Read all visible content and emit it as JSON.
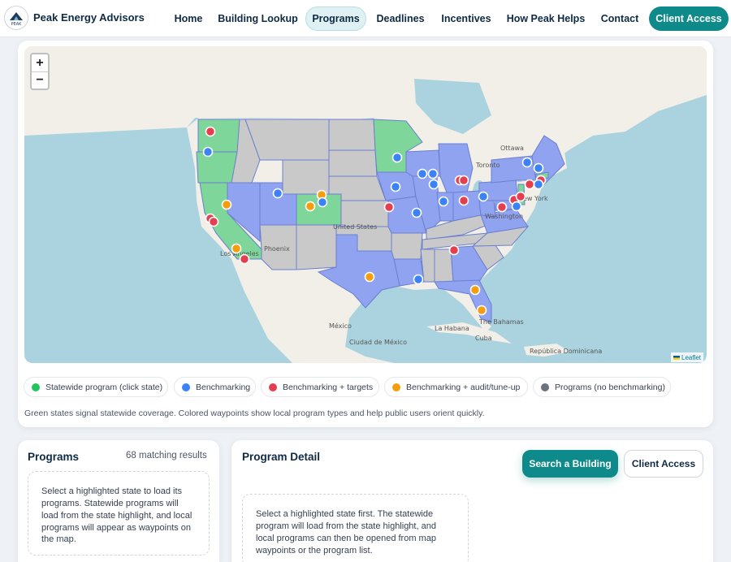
{
  "brand": {
    "name": "Peak Energy Advisors",
    "logo_text": "PEAK",
    "logo_icon": "mountain-icon"
  },
  "nav": {
    "items": [
      {
        "label": "Home",
        "active": false
      },
      {
        "label": "Building Lookup",
        "active": false
      },
      {
        "label": "Programs",
        "active": true
      },
      {
        "label": "Deadlines",
        "active": false
      },
      {
        "label": "Incentives",
        "active": false
      },
      {
        "label": "How Peak Helps",
        "active": false
      },
      {
        "label": "Contact",
        "active": false
      }
    ],
    "cta": "Client Access"
  },
  "map": {
    "zoom_in": "+",
    "zoom_out": "−",
    "attribution": "Leaflet",
    "place_labels": [
      "Ottawa",
      "Toronto",
      "New York",
      "Washington",
      "United States",
      "Phoenix",
      "Los Angeles",
      "México",
      "Ciudad de México",
      "La Habana",
      "Cuba",
      "The Bahamas",
      "República Dominicana"
    ],
    "colors": {
      "water": "#aad3df",
      "land": "#f2efe9",
      "statewide": "#7fd69a",
      "benchmarking": "#8fa3f0",
      "no_benchmarking": "#c9c9c9",
      "dot_benchmarking": "#3b82f6",
      "dot_targets": "#e53e4f",
      "dot_audit": "#f59e0b",
      "dot_none": "#6b7280",
      "dot_statewide": "#22c55e"
    }
  },
  "legend": [
    {
      "label": "Statewide program (click state)",
      "color": "#22c55e"
    },
    {
      "label": "Benchmarking",
      "color": "#3b82f6"
    },
    {
      "label": "Benchmarking + targets",
      "color": "#e53e4f"
    },
    {
      "label": "Benchmarking + audit/tune-up",
      "color": "#f59e0b"
    },
    {
      "label": "Programs (no benchmarking)",
      "color": "#6b7280"
    }
  ],
  "caption": "Green states signal statewide coverage. Colored waypoints show local program types and help public users orient quickly.",
  "programs": {
    "title": "Programs",
    "count": "68 matching results",
    "empty": "Select a highlighted state to load its programs. Statewide programs will load from the state highlight, and local programs will appear as waypoints on the map."
  },
  "detail": {
    "title": "Program Detail",
    "search_button": "Search a Building",
    "client_button": "Client Access",
    "empty": "Select a highlighted state first. The statewide program will load from the state highlight, and local programs can then be opened from map waypoints or the program list."
  }
}
